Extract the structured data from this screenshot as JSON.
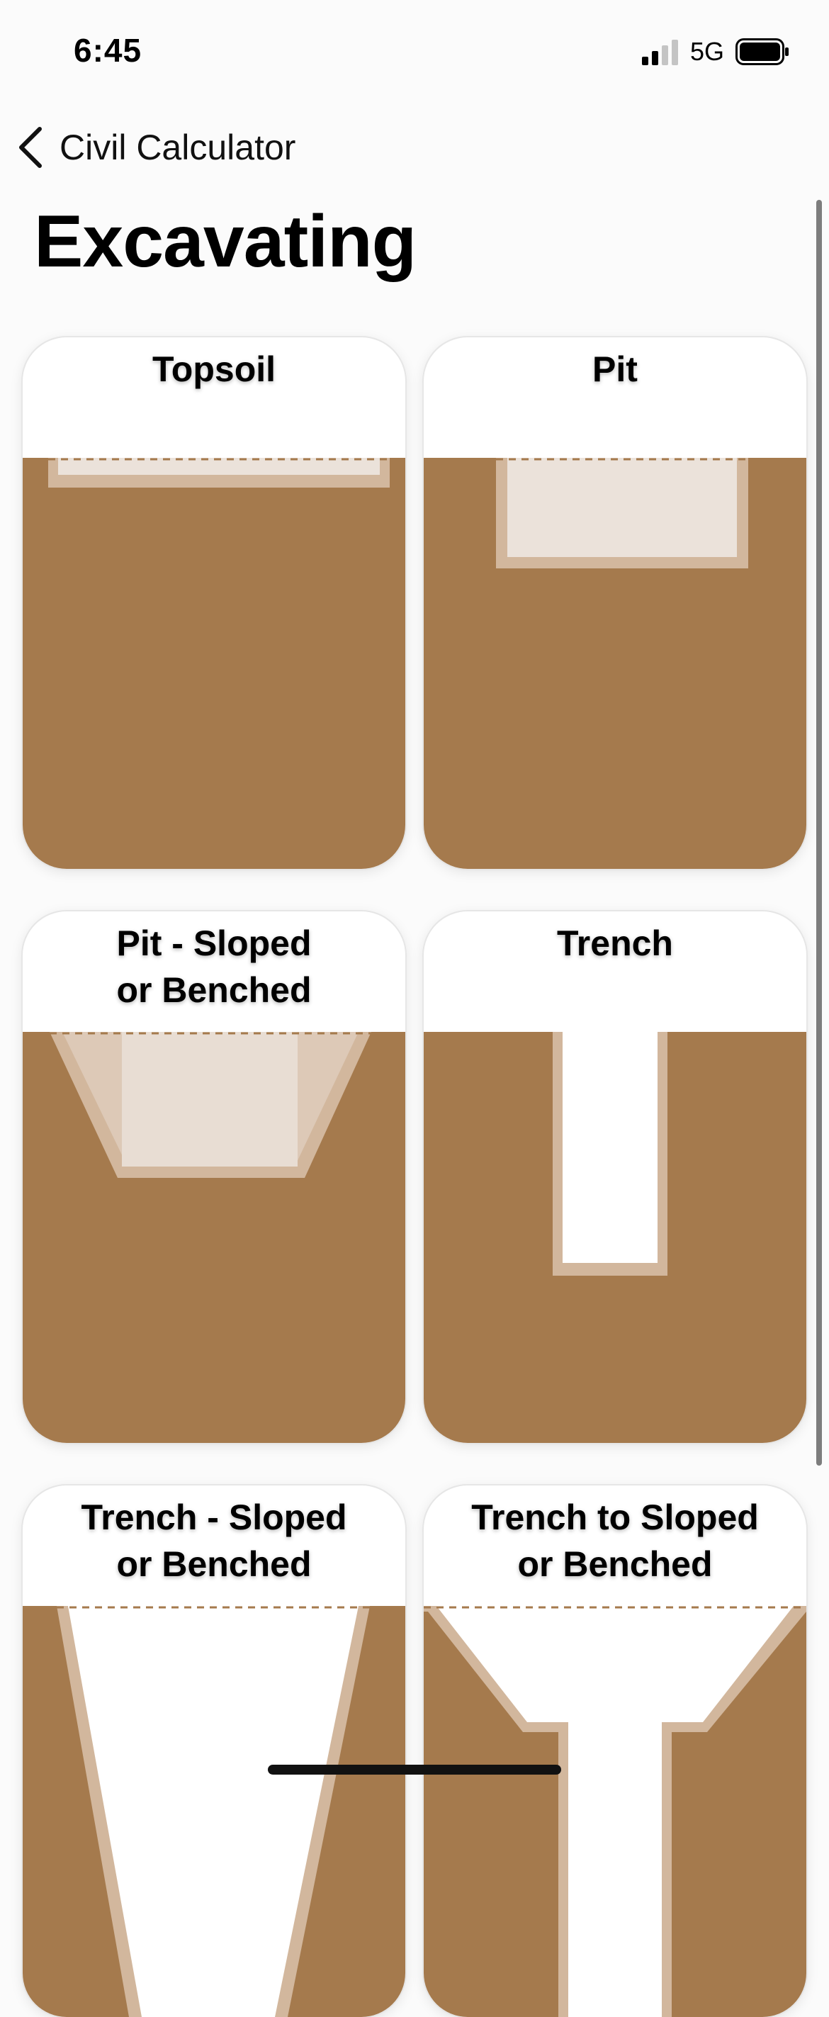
{
  "status_bar": {
    "time": "6:45",
    "network": "5G"
  },
  "nav": {
    "back_label": "Civil Calculator"
  },
  "page": {
    "title": "Excavating"
  },
  "cards": [
    {
      "label": "Topsoil"
    },
    {
      "label": "Pit"
    },
    {
      "label": "Pit - Sloped\nor Benched"
    },
    {
      "label": "Trench"
    },
    {
      "label": "Trench - Sloped\nor Benched"
    },
    {
      "label": "Trench to Sloped\nor Benched"
    }
  ],
  "colors": {
    "soil": "#a57a4d",
    "rim": "#d2b79d",
    "fill": "#ebe2da",
    "cut": "#ffffff"
  }
}
